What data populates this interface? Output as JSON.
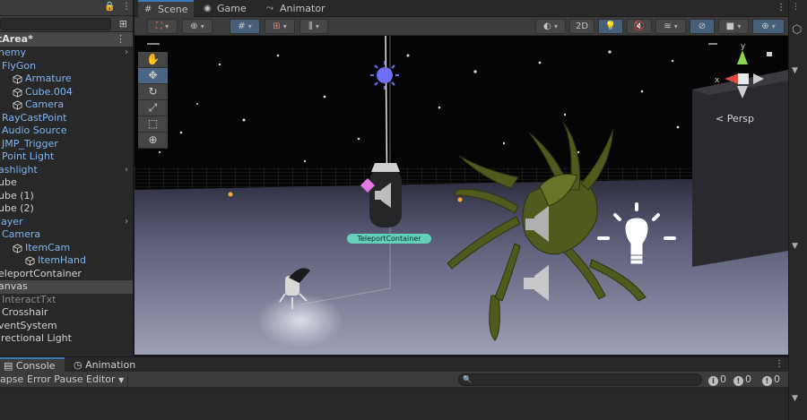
{
  "hierarchy": {
    "scene_name": "tArea*",
    "items": [
      {
        "label": "nemy",
        "style": "blue",
        "indent": 0,
        "icon": false,
        "arrow": true
      },
      {
        "label": "FlyGon",
        "style": "blue",
        "indent": 0,
        "icon": false,
        "arrow": false,
        "prefix": "I "
      },
      {
        "label": "Armature",
        "style": "blue",
        "indent": 1,
        "icon": true,
        "arrow": false
      },
      {
        "label": "Cube.004",
        "style": "blue",
        "indent": 1,
        "icon": true,
        "arrow": false
      },
      {
        "label": "Camera",
        "style": "blue",
        "indent": 1,
        "icon": true,
        "arrow": false
      },
      {
        "label": "RayCastPoint",
        "style": "blue",
        "indent": 0,
        "icon": false,
        "arrow": false,
        "prefix": "I "
      },
      {
        "label": "Audio Source",
        "style": "blue",
        "indent": 0,
        "icon": false,
        "arrow": false,
        "prefix": "I "
      },
      {
        "label": "JMP_Trigger",
        "style": "blue",
        "indent": 0,
        "icon": false,
        "arrow": false,
        "prefix": "I "
      },
      {
        "label": "Point Light",
        "style": "blue",
        "indent": 0,
        "icon": false,
        "arrow": false,
        "prefix": "I "
      },
      {
        "label": "ashlight",
        "style": "blue",
        "indent": 0,
        "icon": false,
        "arrow": true
      },
      {
        "label": "ube",
        "style": "white",
        "indent": 0,
        "icon": false,
        "arrow": false
      },
      {
        "label": "ube (1)",
        "style": "white",
        "indent": 0,
        "icon": false,
        "arrow": false
      },
      {
        "label": "ube (2)",
        "style": "white",
        "indent": 0,
        "icon": false,
        "arrow": false
      },
      {
        "label": "layer",
        "style": "blue",
        "indent": 0,
        "icon": false,
        "arrow": true
      },
      {
        "label": "Camera",
        "style": "blue",
        "indent": 0,
        "icon": false,
        "arrow": false,
        "prefix": "I "
      },
      {
        "label": "ItemCam",
        "style": "blue",
        "indent": 1,
        "icon": true,
        "arrow": false
      },
      {
        "label": "ItemHand",
        "style": "blue",
        "indent": 2,
        "icon": true,
        "arrow": false
      },
      {
        "label": "eleportContainer",
        "style": "white",
        "indent": 0,
        "icon": false,
        "arrow": false
      },
      {
        "label": "anvas",
        "style": "white",
        "indent": 0,
        "icon": false,
        "arrow": false,
        "selected": true
      },
      {
        "label": "InteractTxt",
        "style": "dim",
        "indent": 0,
        "icon": false,
        "arrow": false,
        "prefix": "I "
      },
      {
        "label": "Crosshair",
        "style": "white",
        "indent": 0,
        "icon": false,
        "arrow": false,
        "prefix": "I "
      },
      {
        "label": "ventSystem",
        "style": "white",
        "indent": 0,
        "icon": false,
        "arrow": false
      },
      {
        "label": "irectional Light",
        "style": "white",
        "indent": 0,
        "icon": false,
        "arrow": false
      }
    ]
  },
  "scene_tabs": [
    {
      "label": "Scene",
      "icon": "grid-icon",
      "glyph": "#",
      "active": true
    },
    {
      "label": "Game",
      "icon": "gamepad-icon",
      "glyph": "◉",
      "active": false
    },
    {
      "label": "Animator",
      "icon": "animator-icon",
      "glyph": "⤳",
      "active": false
    }
  ],
  "scene_toolbar": {
    "two_d_label": "2D",
    "buttons": [
      "draw-mode-button",
      "global-pivot-button",
      "grid-snap-button",
      "increment-snap-button",
      "ruler-button",
      "shading-button",
      "2d-toggle",
      "lighting-toggle",
      "audio-toggle",
      "effects-toggle",
      "visibility-toggle",
      "camera-button",
      "gizmos-button"
    ]
  },
  "viewport": {
    "persp_label": "< Persp",
    "teleport_label": "TeleportContainer",
    "axis_labels": {
      "y": "y",
      "x": "x"
    },
    "tools": [
      {
        "name": "hand-tool",
        "glyph": "✋",
        "active": false
      },
      {
        "name": "move-tool",
        "glyph": "✥",
        "active": true
      },
      {
        "name": "rotate-tool",
        "glyph": "↻",
        "active": false
      },
      {
        "name": "scale-tool",
        "glyph": "⤢",
        "active": false
      },
      {
        "name": "rect-tool",
        "glyph": "⬚",
        "active": false
      },
      {
        "name": "transform-tool",
        "glyph": "⊕",
        "active": false
      }
    ]
  },
  "console": {
    "tabs": [
      {
        "label": "Console",
        "icon": "console-icon",
        "active": true
      },
      {
        "label": "Animation",
        "icon": "animation-icon",
        "active": false
      }
    ],
    "toolbar": {
      "collapse": "apse",
      "error_pause": "Error Pause",
      "editor": "Editor",
      "search_placeholder": "🔍",
      "counts": {
        "info": "0",
        "warning": "0",
        "error": "0"
      }
    }
  },
  "colors": {
    "accent": "#3a79bb",
    "hierarchy_blue": "#7fb6f4",
    "teleport_label": "#63d1b9",
    "creature": "#4f5a1c",
    "sky": "#050505",
    "ground": "#8d8fa6"
  }
}
